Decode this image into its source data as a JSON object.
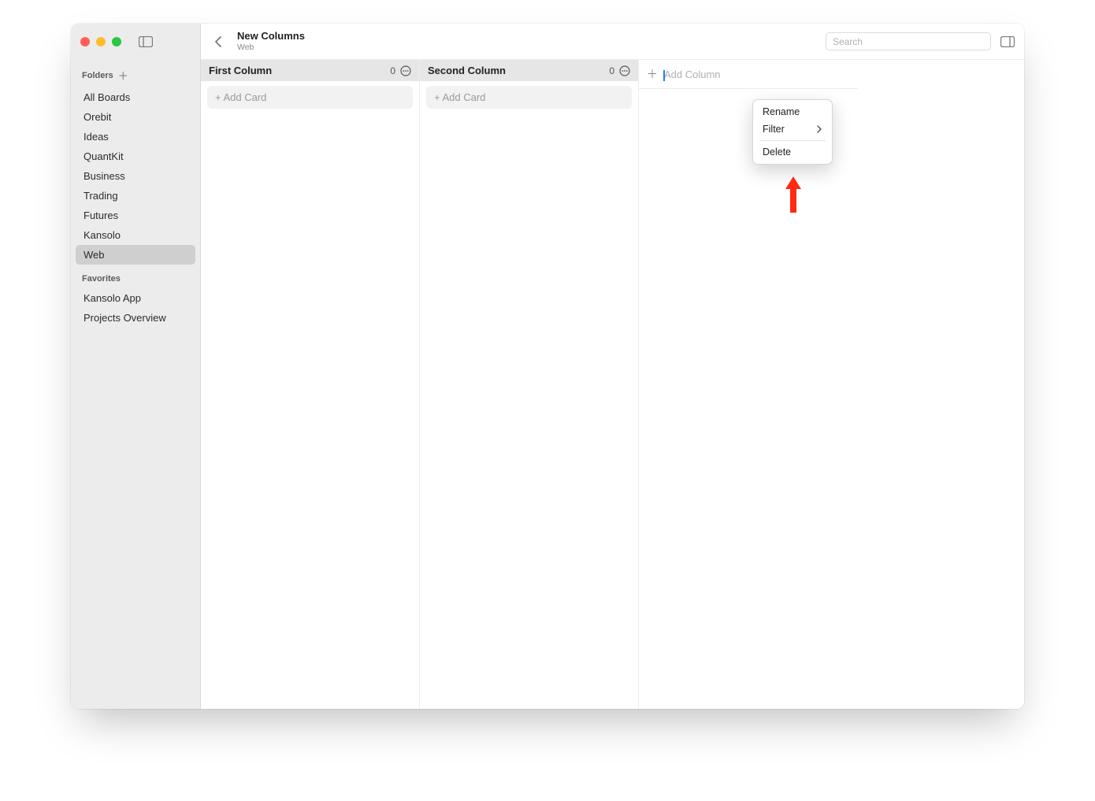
{
  "window": {
    "title": "New Columns",
    "subtitle": "Web"
  },
  "search": {
    "placeholder": "Search"
  },
  "sidebar": {
    "folders_label": "Folders",
    "favorites_label": "Favorites",
    "folders": [
      {
        "label": "All Boards",
        "selected": false
      },
      {
        "label": "Orebit",
        "selected": false
      },
      {
        "label": "Ideas",
        "selected": false
      },
      {
        "label": "QuantKit",
        "selected": false
      },
      {
        "label": "Business",
        "selected": false
      },
      {
        "label": "Trading",
        "selected": false
      },
      {
        "label": "Futures",
        "selected": false
      },
      {
        "label": "Kansolo",
        "selected": false
      },
      {
        "label": "Web",
        "selected": true
      }
    ],
    "favorites": [
      {
        "label": "Kansolo App"
      },
      {
        "label": "Projects Overview"
      }
    ]
  },
  "board": {
    "add_card_label": "+ Add Card",
    "add_column_label": "Add Column",
    "columns": [
      {
        "title": "First Column",
        "count": 0
      },
      {
        "title": "Second Column",
        "count": 0
      }
    ]
  },
  "context_menu": {
    "rename": "Rename",
    "filter": "Filter",
    "delete": "Delete"
  }
}
